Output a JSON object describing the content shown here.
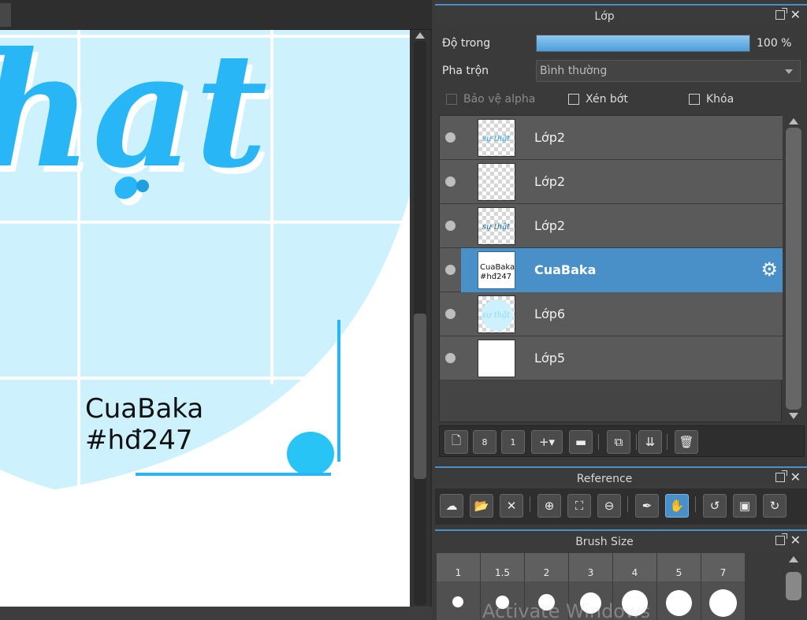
{
  "canvas": {
    "script_text": "hạt",
    "signature_line1": "CuaBaka",
    "signature_line2": "#hđ247"
  },
  "layer_panel": {
    "title": "Lớp",
    "opacity_label": "Độ trong",
    "opacity_value": "100 %",
    "opacity_percent": 100,
    "blend_label": "Pha trộn",
    "blend_value": "Bình thường",
    "protect_alpha_label": "Bảo vệ alpha",
    "clipping_label": "Xén bớt",
    "lock_label": "Khóa",
    "layers": [
      {
        "name": "Lớp2"
      },
      {
        "name": "Lớp2"
      },
      {
        "name": "Lớp2"
      },
      {
        "name": "CuaBaka"
      },
      {
        "name": "Lớp6"
      },
      {
        "name": "Lớp5"
      }
    ],
    "thumb_captions": {
      "thumb1": "sự thật",
      "thumb3": "sự thật",
      "thumb4_line1": "CuaBaka",
      "thumb4_line2": "#hđ247",
      "thumb5": "sự thật"
    },
    "toolbar_icons": [
      "new-layer-icon",
      "new-8bit-layer-icon",
      "new-1bit-layer-icon",
      "add-layer-menu-icon",
      "new-folder-icon",
      "duplicate-layer-icon",
      "merge-layer-icon",
      "delete-layer-icon"
    ]
  },
  "reference_panel": {
    "title": "Reference",
    "toolbar_icons": [
      "cloud-open-icon",
      "folder-open-icon",
      "close-icon",
      "zoom-in-icon",
      "fit-icon",
      "zoom-out-icon",
      "eyedropper-icon",
      "hand-icon",
      "rotate-left-icon",
      "fit-screen-icon",
      "rotate-right-icon"
    ]
  },
  "brush_panel": {
    "title": "Brush Size",
    "sizes": [
      "1",
      "1.5",
      "2",
      "3",
      "4",
      "5",
      "7"
    ]
  },
  "watermark": "Activate Windows",
  "colors": {
    "accent": "#4a90c8",
    "canvas_blue": "#29b6f6",
    "light_blue": "#cdf1fd"
  }
}
